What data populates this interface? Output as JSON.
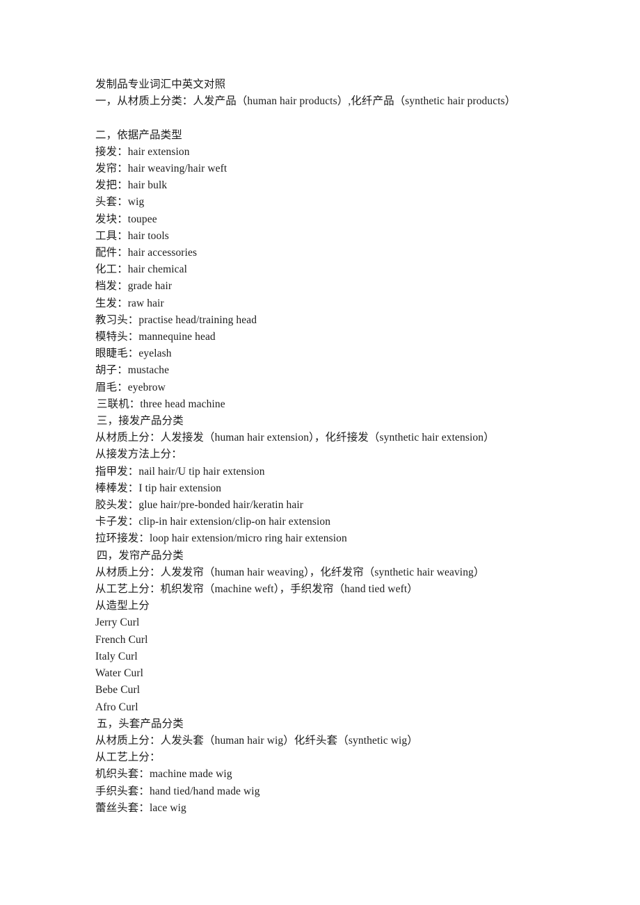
{
  "document": {
    "title": "发制品专业词汇中英文对照",
    "lines": [
      {
        "text": "发制品专业词汇中英文对照",
        "indent": false
      },
      {
        "text": "一，从材质上分类：人发产品（human hair products）,化纤产品（synthetic hair products）",
        "indent": false
      },
      {
        "text": "",
        "indent": false
      },
      {
        "text": "二，依据产品类型",
        "indent": false
      },
      {
        "text": "接发：hair extension",
        "indent": false
      },
      {
        "text": "发帘：hair weaving/hair weft",
        "indent": false
      },
      {
        "text": "发把：hair bulk",
        "indent": false
      },
      {
        "text": "头套：wig",
        "indent": false
      },
      {
        "text": "发块：toupee",
        "indent": false
      },
      {
        "text": "工具：hair tools",
        "indent": false
      },
      {
        "text": "配件：hair accessories",
        "indent": false
      },
      {
        "text": "化工：hair chemical",
        "indent": false
      },
      {
        "text": "档发：grade hair",
        "indent": false
      },
      {
        "text": "生发：raw hair",
        "indent": false
      },
      {
        "text": "教习头：practise head/training head",
        "indent": false
      },
      {
        "text": "模特头：mannequine head",
        "indent": false
      },
      {
        "text": "眼睫毛：eyelash",
        "indent": false
      },
      {
        "text": "胡子：mustache",
        "indent": false
      },
      {
        "text": "眉毛：eyebrow",
        "indent": false
      },
      {
        "text": "三联机：three head machine",
        "indent": true
      },
      {
        "text": "三，接发产品分类",
        "indent": true
      },
      {
        "text": "从材质上分：人发接发（human hair extension），化纤接发（synthetic hair extension）",
        "indent": false
      },
      {
        "text": "从接发方法上分：",
        "indent": false
      },
      {
        "text": "指甲发：nail hair/U tip hair extension",
        "indent": false
      },
      {
        "text": "棒棒发：I tip hair extension",
        "indent": false
      },
      {
        "text": "胶头发：glue hair/pre-bonded hair/keratin hair",
        "indent": false
      },
      {
        "text": "卡子发：clip-in hair extension/clip-on hair extension",
        "indent": false
      },
      {
        "text": "拉环接发：loop hair extension/micro ring hair extension",
        "indent": false
      },
      {
        "text": "四，发帘产品分类",
        "indent": true
      },
      {
        "text": "从材质上分：人发发帘（human hair weaving），化纤发帘（synthetic hair weaving）",
        "indent": false
      },
      {
        "text": "从工艺上分：机织发帘（machine weft），手织发帘（hand tied weft）",
        "indent": false
      },
      {
        "text": "从造型上分",
        "indent": false
      },
      {
        "text": "Jerry Curl",
        "indent": false
      },
      {
        "text": "French Curl",
        "indent": false
      },
      {
        "text": "Italy Curl",
        "indent": false
      },
      {
        "text": "Water Curl",
        "indent": false
      },
      {
        "text": "Bebe Curl",
        "indent": false
      },
      {
        "text": "Afro Curl",
        "indent": false
      },
      {
        "text": "五，头套产品分类",
        "indent": true
      },
      {
        "text": "从材质上分：人发头套（human hair wig）化纤头套（synthetic wig）",
        "indent": false
      },
      {
        "text": "从工艺上分：",
        "indent": false
      },
      {
        "text": "机织头套：machine made wig",
        "indent": false
      },
      {
        "text": "手织头套：hand tied/hand made wig",
        "indent": false
      },
      {
        "text": "蕾丝头套：lace wig",
        "indent": false
      }
    ]
  }
}
